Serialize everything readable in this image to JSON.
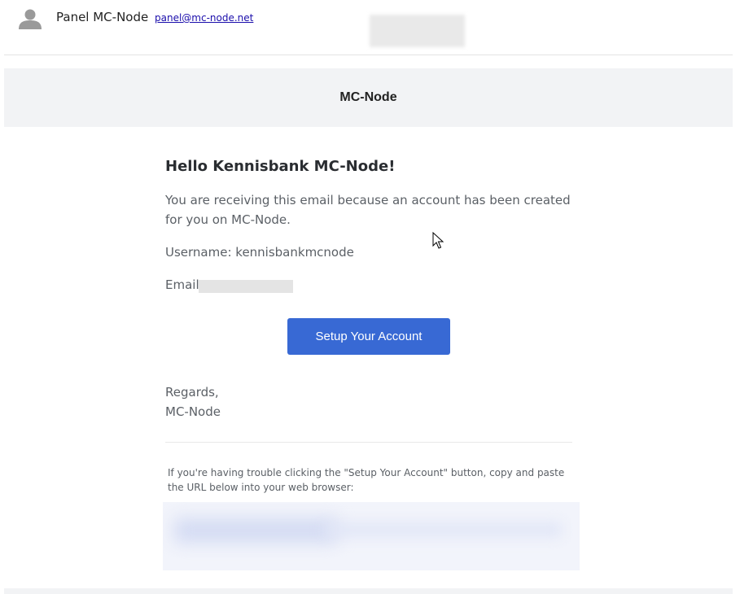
{
  "sender": {
    "name": "Panel MC-Node",
    "email": "panel@mc-node.net"
  },
  "banner": {
    "title": "MC-Node"
  },
  "email": {
    "greeting": "Hello Kennisbank MC-Node!",
    "intro": "You are receiving this email because an account has been created for you on MC-Node.",
    "username_line": "Username: kennisbankmcnode",
    "email_label": "Email:",
    "cta_label": "Setup Your Account",
    "regards": "Regards,",
    "signature": "MC-Node",
    "footnote": "If you're having trouble clicking the \"Setup Your Account\" button, copy and paste the URL below into your web browser:"
  },
  "colors": {
    "button": "#3869d4",
    "banner_bg": "#f2f3f5",
    "body_text": "#5b6066",
    "link": "#1a0dab"
  },
  "icons": {
    "avatar": "person-icon",
    "cursor": "mouse-pointer-icon"
  }
}
